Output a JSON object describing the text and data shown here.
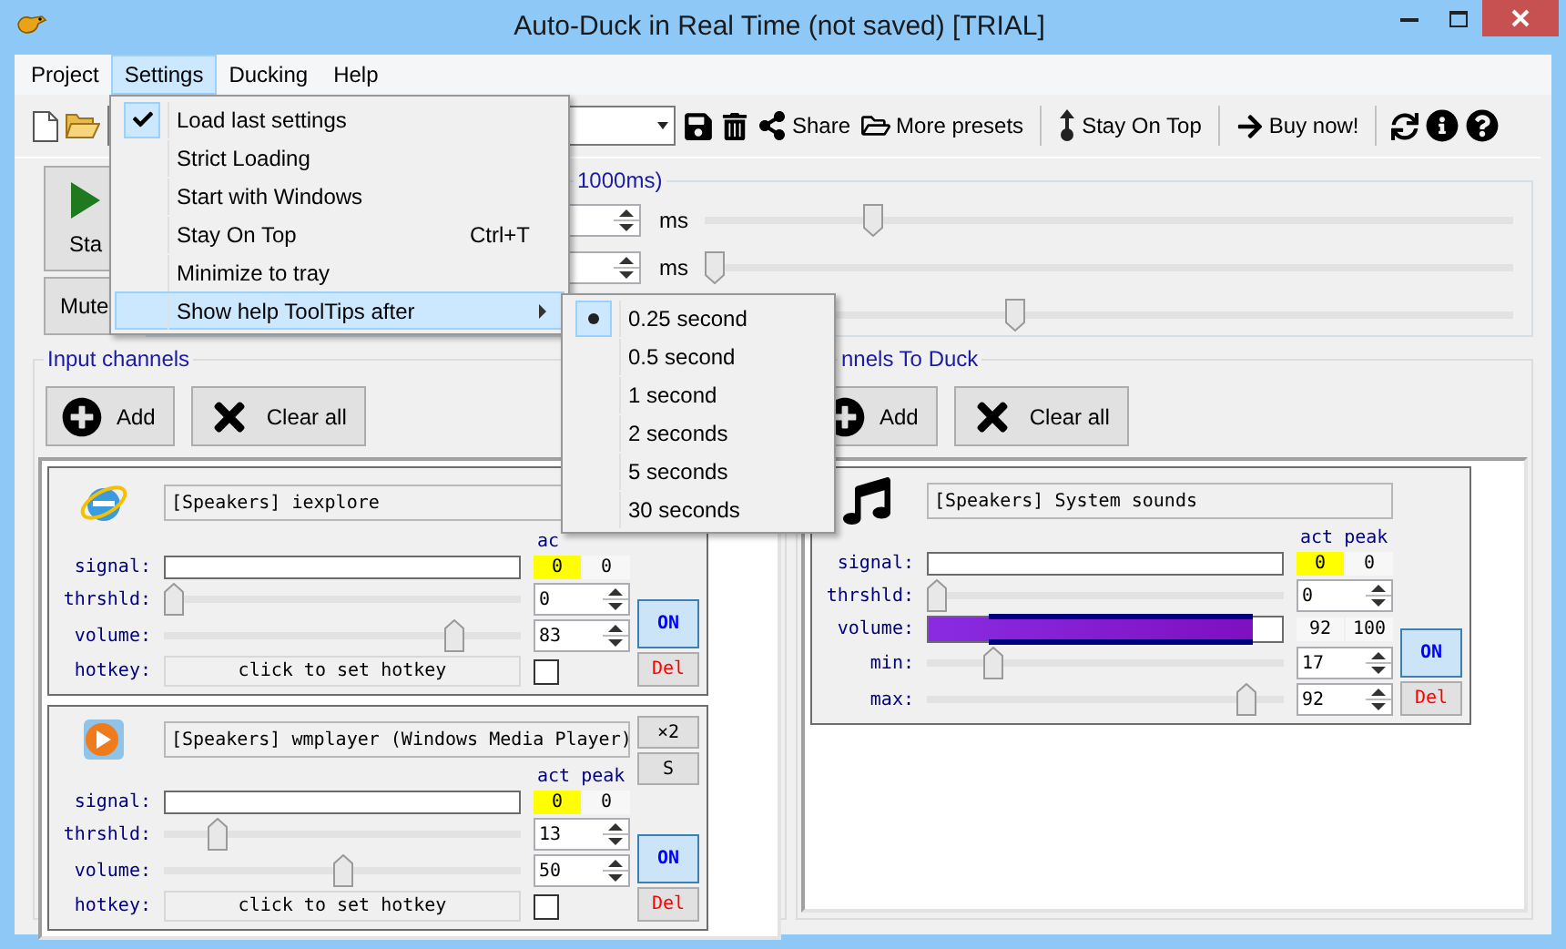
{
  "window": {
    "title": "Auto-Duck in Real Time (not saved) [TRIAL]"
  },
  "menu_bar": [
    {
      "label": "Project",
      "selected": false
    },
    {
      "label": "Settings",
      "selected": true
    },
    {
      "label": "Ducking",
      "selected": false
    },
    {
      "label": "Help",
      "selected": false
    }
  ],
  "settings_menu": [
    {
      "kind": "check",
      "label": "Load last settings",
      "checked": true,
      "selected": false
    },
    {
      "kind": "check",
      "label": "Strict Loading",
      "checked": false,
      "selected": false
    },
    {
      "kind": "check",
      "label": "Start with Windows",
      "checked": false,
      "selected": false
    },
    {
      "kind": "check",
      "label": "Stay On Top",
      "checked": false,
      "selected": false,
      "shortcut": "Ctrl+T"
    },
    {
      "kind": "check",
      "label": "Minimize to tray",
      "checked": false,
      "selected": false
    },
    {
      "kind": "submenu",
      "label": "Show help ToolTips after",
      "selected": true
    }
  ],
  "tooltip_delay_menu": [
    {
      "label": "0.25 second",
      "selected": true
    },
    {
      "label": "0.5 second",
      "selected": false
    },
    {
      "label": "1 second",
      "selected": false
    },
    {
      "label": "2 seconds",
      "selected": false
    },
    {
      "label": "5 seconds",
      "selected": false
    },
    {
      "label": "30 seconds",
      "selected": false
    }
  ],
  "toolbar": {
    "buttons": [
      "Share",
      "More presets",
      "Stay On Top",
      "Buy now!"
    ]
  },
  "timing": {
    "title": "1000ms)",
    "start_button": "Sta",
    "mute_button": "Mute",
    "rows": [
      {
        "unit": "ms",
        "level": 0.2
      },
      {
        "unit": "ms",
        "level": 0
      },
      {
        "level": 0.38
      }
    ]
  },
  "input_channels": {
    "title": "Input channels",
    "add_button": "Add",
    "clear_button": "Clear all",
    "channels": [
      {
        "name": "[Speakers] iexplore",
        "meter_header": "ac",
        "toggle": {
          "label": "ON",
          "on": true
        },
        "delete_button": "Del",
        "rows": [
          {
            "kind": "meter",
            "label": "signal:",
            "act": "0",
            "peak": "0"
          },
          {
            "kind": "slider",
            "label": "thrshld:",
            "level": 0,
            "value": "0"
          },
          {
            "kind": "slider",
            "label": "volume:",
            "level": 0.83,
            "value": "83"
          },
          {
            "kind": "hotkey",
            "label": "hotkey:",
            "text": "click to set hotkey",
            "checked": false
          }
        ]
      },
      {
        "name": "[Speakers] wmplayer (Windows Media Player)",
        "meter_header": "act peak",
        "side_buttons": [
          "×2",
          "S"
        ],
        "toggle": {
          "label": "ON",
          "on": true
        },
        "delete_button": "Del",
        "rows": [
          {
            "kind": "meter",
            "label": "signal:",
            "act": "0",
            "peak": "0"
          },
          {
            "kind": "slider",
            "label": "thrshld:",
            "level": 0.13,
            "value": "13"
          },
          {
            "kind": "slider",
            "label": "volume:",
            "level": 0.5,
            "value": "50"
          },
          {
            "kind": "hotkey",
            "label": "hotkey:",
            "text": "click to set hotkey",
            "checked": false
          }
        ]
      }
    ]
  },
  "duck_channels": {
    "title": "nnels To Duck",
    "add_button": "Add",
    "clear_button": "Clear all",
    "channels": [
      {
        "name": "[Speakers] System sounds",
        "meter_header": "act peak",
        "toggle": {
          "label": "ON",
          "on": true
        },
        "delete_button": "Del",
        "rows": [
          {
            "kind": "meter",
            "label": "signal:",
            "act": "0",
            "peak": "0"
          },
          {
            "kind": "slider",
            "label": "thrshld:",
            "level": 0,
            "value": "0"
          },
          {
            "kind": "range",
            "label": "volume:",
            "level": 0.92,
            "value": "92",
            "max": "100"
          },
          {
            "kind": "slider",
            "label": "min:",
            "level": 0.17,
            "value": "17"
          },
          {
            "kind": "slider",
            "label": "max:",
            "level": 0.92,
            "value": "92"
          }
        ]
      }
    ]
  }
}
